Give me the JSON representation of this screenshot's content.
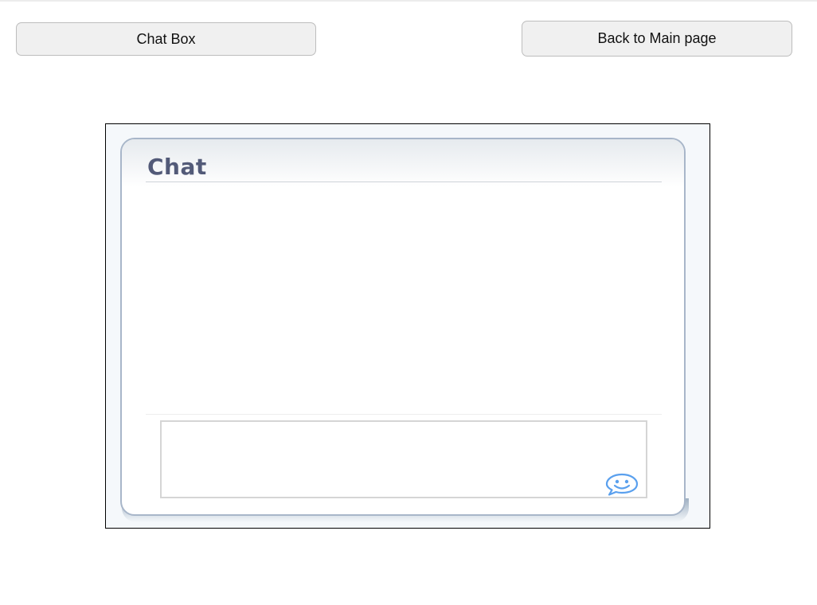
{
  "toolbar": {
    "chat_box_label": "Chat Box",
    "back_label": "Back to Main page"
  },
  "chat": {
    "title": "Chat",
    "input_value": "",
    "input_placeholder": "",
    "emoji_icon": "smiley-speech-bubble-icon"
  },
  "colors": {
    "button_bg": "#f0f0f0",
    "title_color": "#525a78",
    "panel_border": "#a8b6c9",
    "emoji_color": "#5aa0ee"
  }
}
